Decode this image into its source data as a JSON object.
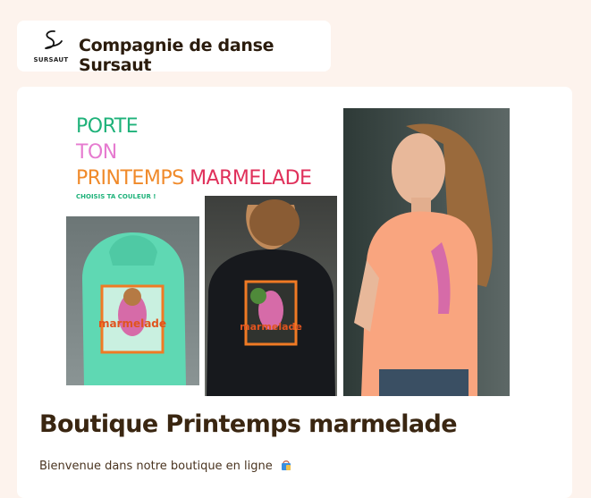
{
  "header": {
    "logo_text": "SURSAUT",
    "org_name": "Compagnie de danse Sursaut"
  },
  "banner": {
    "line1": "PORTE",
    "line2": "TON",
    "line3a": "PRINTEMPS",
    "line3b": "MARMELADE",
    "tagline": "CHOISIS TA COULEUR !",
    "photos": [
      "mint-hoodie-photo",
      "black-hoodie-photo",
      "peach-tshirt-photo"
    ]
  },
  "main": {
    "title": "Boutique Printemps marmelade",
    "welcome": "Bienvenue dans notre boutique en ligne"
  },
  "icons": {
    "logo": "sursaut-logo-icon",
    "bag": "shopping-bag-icon"
  },
  "colors": {
    "page_bg": "#fdf3ed",
    "title": "#3a2611",
    "green": "#1fb27a",
    "pink": "#e67bd0",
    "orange": "#f08a2a",
    "red": "#e0315b"
  }
}
